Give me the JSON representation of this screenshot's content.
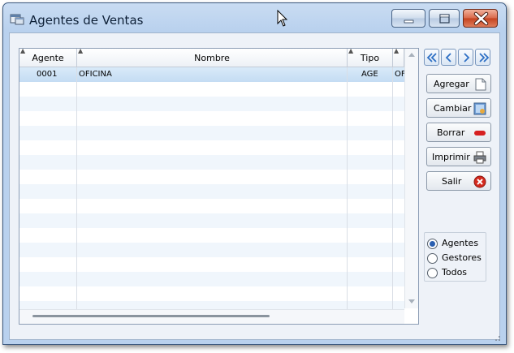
{
  "window": {
    "title": "Agentes de Ventas"
  },
  "grid": {
    "columns": [
      {
        "id": "agente",
        "label": "Agente"
      },
      {
        "id": "nombre",
        "label": "Nombre"
      },
      {
        "id": "tipo",
        "label": "Tipo"
      }
    ],
    "rows": [
      {
        "agente": "0001",
        "nombre": "OFICINA",
        "tipo": "AGE",
        "extra": "OF"
      }
    ]
  },
  "toolbar": {
    "agregar_label": "Agregar",
    "cambiar_label": "Cambiar",
    "borrar_label": "Borrar",
    "imprimir_label": "Imprimir",
    "salir_label": "Salir"
  },
  "filter": {
    "options": [
      {
        "label": "Agentes",
        "checked": true
      },
      {
        "label": "Gestores",
        "checked": false
      },
      {
        "label": "Todos",
        "checked": false
      }
    ]
  },
  "icons": {
    "app": "app-window-icon",
    "first": "double-chevron-left-icon",
    "prev": "chevron-left-icon",
    "next": "chevron-right-icon",
    "last": "double-chevron-right-icon",
    "agregar": "new-document-icon",
    "cambiar": "edit-picture-icon",
    "borrar": "red-minus-icon",
    "imprimir": "printer-icon",
    "salir": "red-x-circle-icon"
  },
  "colors": {
    "accent": "#2a5fb0",
    "title_bar": "#c9dcf2",
    "selected_row": "#c4dcf3",
    "close_button": "#c4411e"
  }
}
